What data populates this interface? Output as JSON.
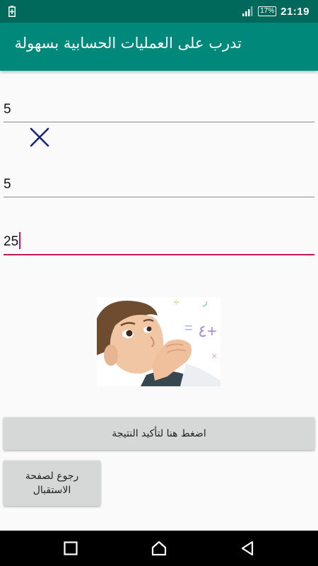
{
  "status_bar": {
    "battery": "17%",
    "time": "21:19"
  },
  "app_bar": {
    "title": "تدرب على العمليات الحسابية بسهولة"
  },
  "form": {
    "operand1": "5",
    "operator_icon": "multiply-icon",
    "operand2": "5",
    "result": "25"
  },
  "buttons": {
    "confirm": "اضغط هنا لتأكيد النتيجة",
    "home": "رجوع لصفحة الاستقبال"
  },
  "colors": {
    "status_bar": "#00695c",
    "app_bar": "#00897b",
    "accent": "#c2185b",
    "operator": "#1a237e",
    "button": "#d6d7d7"
  },
  "nav_icons": [
    "recents-square-icon",
    "home-icon",
    "back-triangle-icon"
  ]
}
